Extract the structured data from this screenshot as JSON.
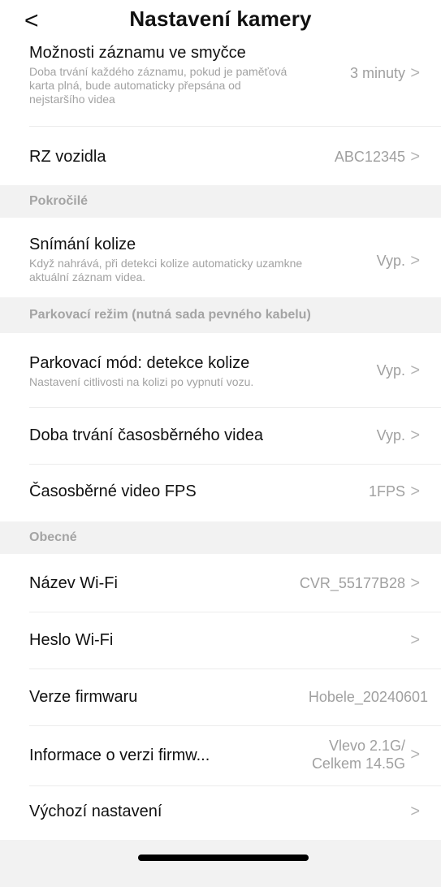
{
  "header": {
    "back_icon": "chevron-left-icon",
    "back_glyph": "<",
    "title": "Nastavení kamery"
  },
  "rows": {
    "loop_recording": {
      "title": "Možnosti záznamu ve smyčce",
      "desc_line1": "Doba trvání každého záznamu, pokud je paměťová",
      "desc_line2": "karta plná, bude automaticky přepsána od",
      "desc_line3": "nejstaršího videa",
      "value": "3 minuty"
    },
    "plate": {
      "title": "RZ vozidla",
      "value": "ABC12345"
    },
    "collision": {
      "title": "Snímání kolize",
      "desc_line1": "Když nahrává, při detekci kolize automaticky uzamkne",
      "desc_line2": "aktuální záznam videa.",
      "value": "Vyp."
    },
    "parking_collision": {
      "title": "Parkovací mód: detekce kolize",
      "desc_line1": "Nastavení citlivosti na kolizi po vypnutí vozu.",
      "value": "Vyp."
    },
    "timelapse_duration": {
      "title": "Doba trvání časosběrného videa",
      "value": "Vyp."
    },
    "timelapse_fps": {
      "title": "Časosběrné video FPS",
      "value": "1FPS"
    },
    "wifi_name": {
      "title": "Název Wi-Fi",
      "value": "CVR_55177B28"
    },
    "wifi_password": {
      "title": "Heslo Wi-Fi",
      "value": ""
    },
    "firmware_version": {
      "title": "Verze firmwaru",
      "value": "Hobele_20240601"
    },
    "firmware_info": {
      "title": "Informace o verzi firmw...",
      "value_line1": "Vlevo 2.1G/",
      "value_line2": "Celkem 14.5G"
    },
    "factory_reset": {
      "title": "Výchozí nastavení"
    }
  },
  "sections": {
    "advanced": "Pokročilé",
    "parking": "Parkovací režim (nutná sada pevného kabelu)",
    "general": "Obecné"
  },
  "chevron": ">"
}
